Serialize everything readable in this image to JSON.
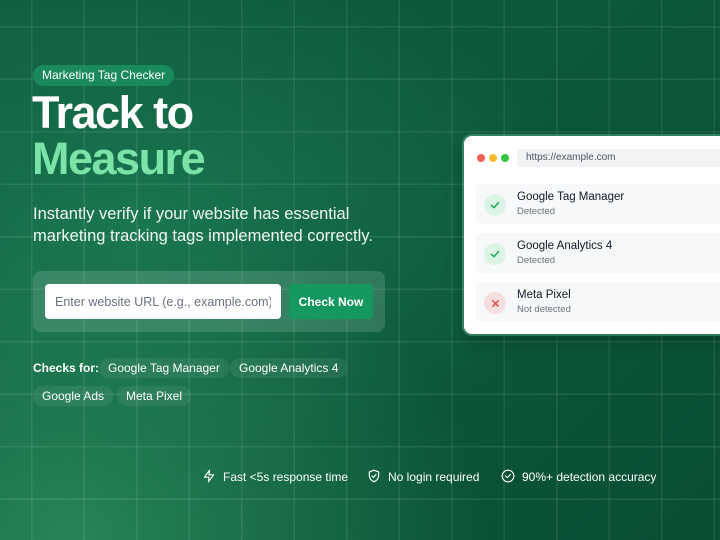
{
  "hero": {
    "badge": "Marketing Tag Checker",
    "title_line1": "Track to",
    "title_line2": "Measure",
    "subtitle": "Instantly verify if your website has essential marketing tracking tags implemented correctly.",
    "accent_color": "#7be3a8"
  },
  "form": {
    "url_placeholder": "Enter website URL (e.g., example.com)",
    "url_value": "",
    "submit_label": "Check Now"
  },
  "checks": {
    "label": "Checks for:",
    "items": [
      "Google Tag Manager",
      "Google Analytics 4",
      "Google Ads",
      "Meta Pixel"
    ]
  },
  "features": [
    {
      "icon": "lightning-icon",
      "text": "Fast <5s response time"
    },
    {
      "icon": "shield-check-icon",
      "text": "No login required"
    },
    {
      "icon": "check-circle-icon",
      "text": "90%+ detection accuracy"
    }
  ],
  "preview": {
    "url": "https://example.com",
    "results": [
      {
        "name": "Google Tag Manager",
        "status": "Detected",
        "state": "ok",
        "icon": "check-icon"
      },
      {
        "name": "Google Analytics 4",
        "status": "Detected",
        "state": "ok",
        "icon": "check-icon"
      },
      {
        "name": "Meta Pixel",
        "status": "Not detected",
        "state": "bad",
        "icon": "x-icon"
      }
    ],
    "colors": {
      "dot_red": "#f25f57",
      "dot_yellow": "#f7bd2e",
      "dot_green": "#2fc840",
      "ok": "#22a45d",
      "bad": "#d64545"
    }
  }
}
